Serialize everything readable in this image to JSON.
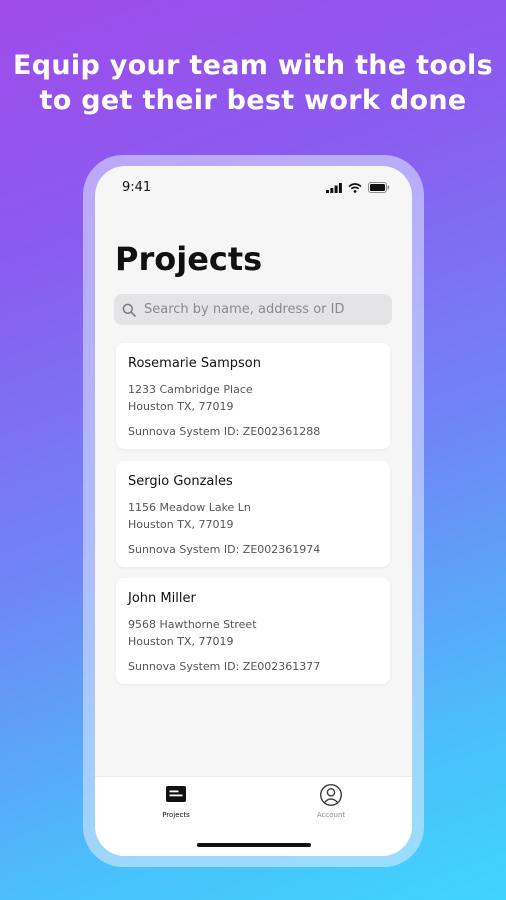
{
  "headline": {
    "line1": "Equip your team with the tools",
    "line2": "to get their best work done"
  },
  "status_bar": {
    "time": "9:41"
  },
  "page": {
    "title": "Projects"
  },
  "search": {
    "placeholder": "Search by name, address or ID"
  },
  "projects": [
    {
      "name": "Rosemarie Sampson",
      "street": "1233 Cambridge Place",
      "city": "Houston TX, 77019",
      "system_id": "Sunnova System ID: ZE002361288"
    },
    {
      "name": "Sergio Gonzales",
      "street": "1156 Meadow Lake Ln",
      "city": "Houston TX, 77019",
      "system_id": "Sunnova System ID: ZE002361974"
    },
    {
      "name": "John Miller",
      "street": "9568 Hawthorne Street",
      "city": "Houston TX, 77019",
      "system_id": "Sunnova System ID: ZE002361377"
    }
  ],
  "tabs": [
    {
      "label": "Projects",
      "icon": "projects-icon",
      "active": true
    },
    {
      "label": "Account",
      "icon": "account-icon",
      "active": false
    }
  ],
  "colors": {
    "gradient_top": "#a04bea",
    "gradient_bottom": "#3fd4fc",
    "active_tab": "#111111",
    "inactive_tab": "#8a8a8e"
  }
}
